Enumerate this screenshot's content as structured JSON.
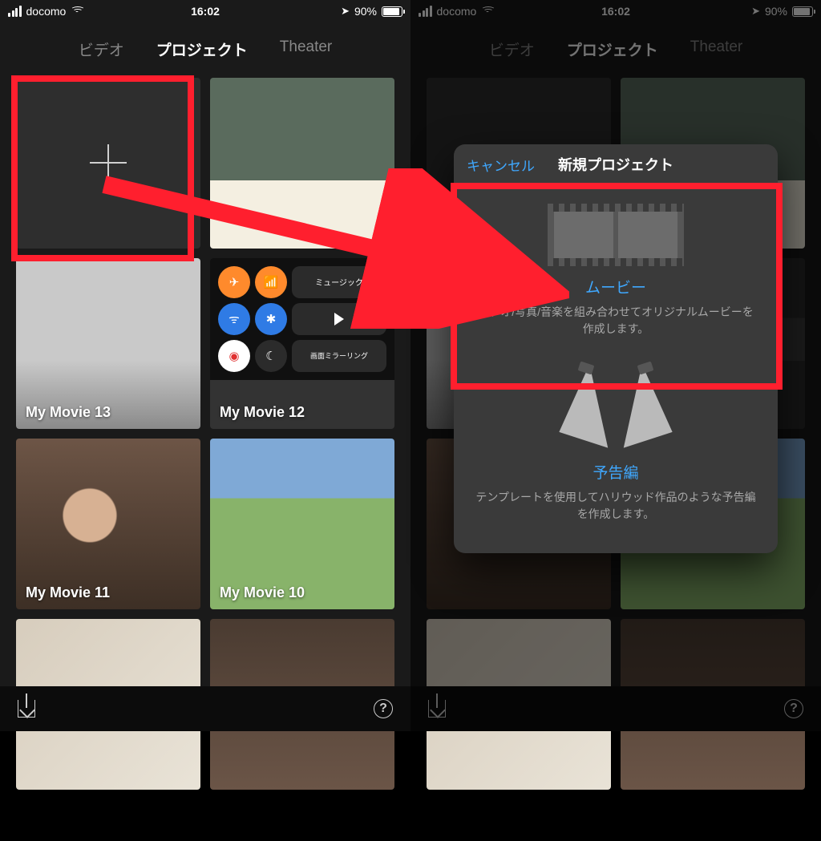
{
  "statusbar": {
    "carrier": "docomo",
    "time": "16:02",
    "battery_percent": "90%"
  },
  "tabs": {
    "video": "ビデオ",
    "project": "プロジェクト",
    "theater": "Theater"
  },
  "projects": [
    {
      "label": ""
    },
    {
      "label": ""
    },
    {
      "label": "My Movie 13"
    },
    {
      "label": "My Movie 12"
    },
    {
      "label": "My Movie 11"
    },
    {
      "label": "My Movie 10"
    },
    {
      "label": ""
    },
    {
      "label": ""
    }
  ],
  "sheet": {
    "cancel": "キャンセル",
    "title": "新規プロジェクト",
    "movie": {
      "title": "ムービー",
      "desc": "ビデオ/写真/音楽を組み合わせてオリジナルムービーを作成します。"
    },
    "trailer": {
      "title": "予告編",
      "desc": "テンプレートを使用してハリウッド作品のような予告編を作成します。"
    }
  },
  "help": "?"
}
